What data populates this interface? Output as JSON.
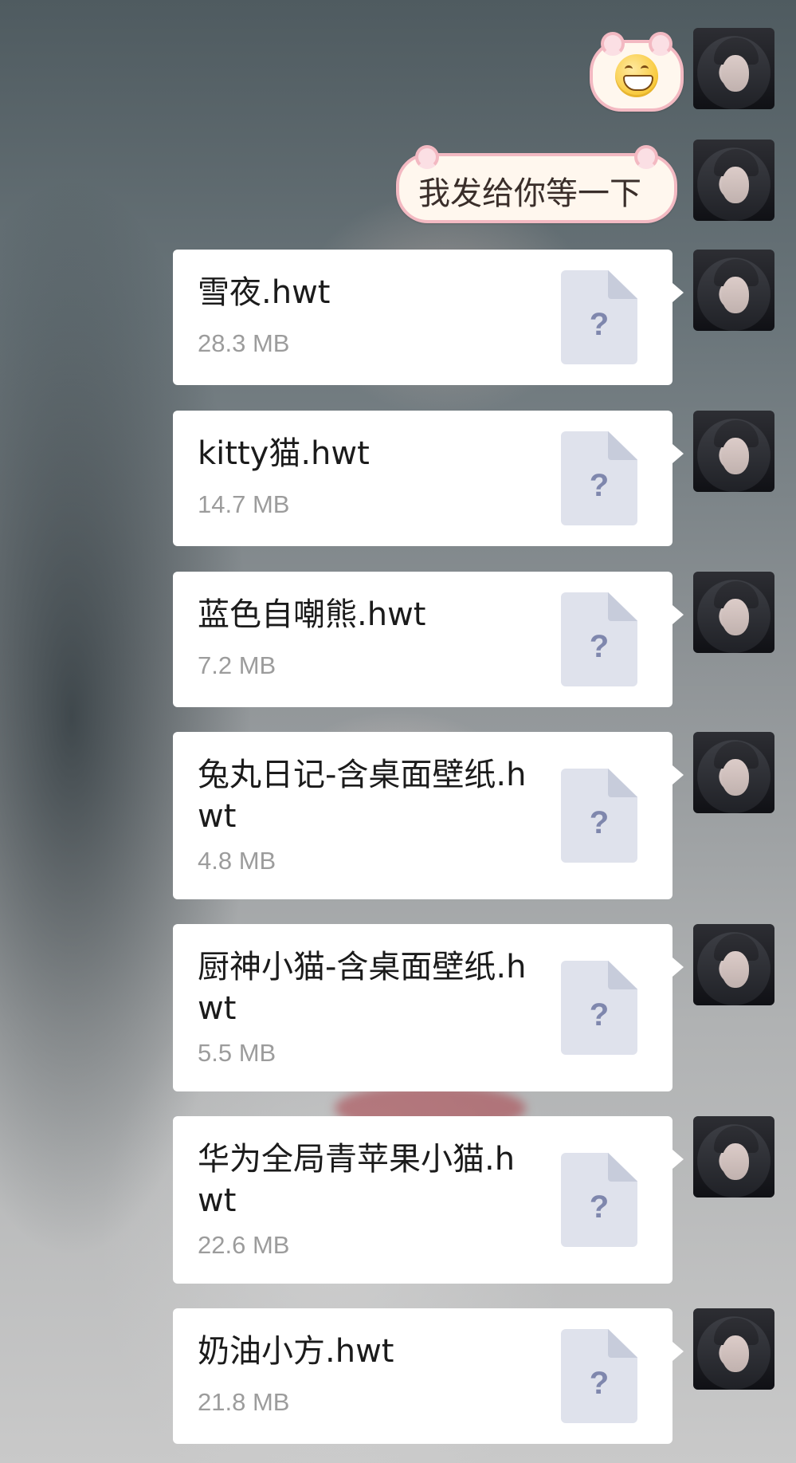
{
  "messages": [
    {
      "type": "sticker",
      "kind": "grin-emoji"
    },
    {
      "type": "sticker-text",
      "text": "我发给你等一下"
    },
    {
      "type": "file",
      "name": "雪夜.hwt",
      "size": "28.3 MB"
    },
    {
      "type": "file",
      "name": "kitty猫.hwt",
      "size": "14.7 MB"
    },
    {
      "type": "file",
      "name": "蓝色自嘲熊.hwt",
      "size": "7.2 MB"
    },
    {
      "type": "file",
      "name": "兔丸日记-含桌面壁纸.hwt",
      "size": "4.8 MB"
    },
    {
      "type": "file",
      "name": "厨神小猫-含桌面壁纸.hwt",
      "size": "5.5 MB"
    },
    {
      "type": "file",
      "name": "华为全局青苹果小猫.hwt",
      "size": "22.6 MB"
    },
    {
      "type": "file",
      "name": "奶油小方.hwt",
      "size": "21.8 MB"
    }
  ],
  "file_icon": {
    "symbol": "?",
    "icon": "unknown-file-icon"
  },
  "colors": {
    "bubble_bg": "#ffffff",
    "sticker_border": "#f3b9c2",
    "size_text": "#9c9c9c",
    "file_icon_bg": "#dfe2ec",
    "file_icon_symbol": "#7f87ad"
  }
}
